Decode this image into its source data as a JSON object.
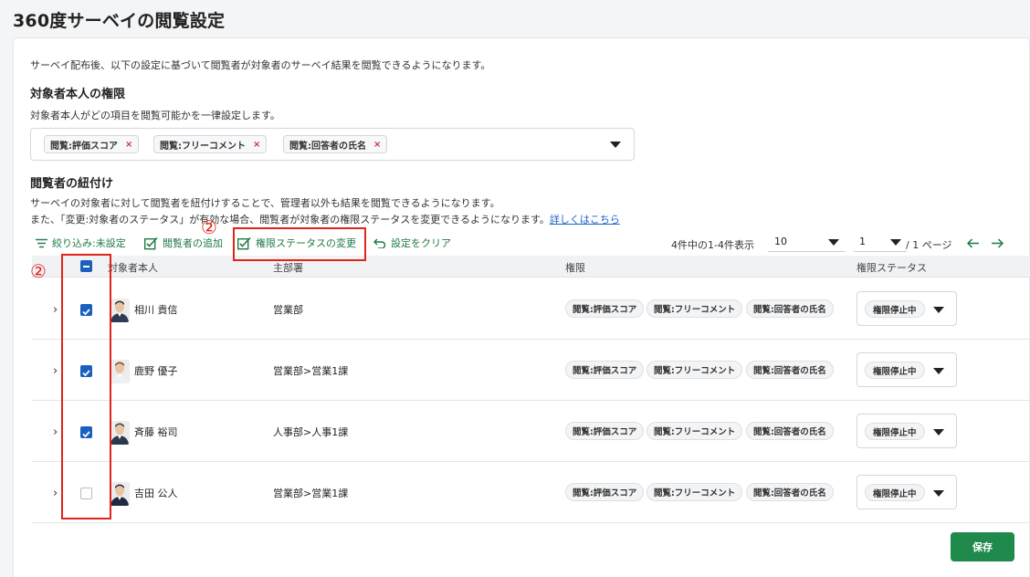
{
  "page": {
    "title": "360度サーベイの閲覧設定"
  },
  "intro": "サーベイ配布後、以下の設定に基づいて閲覧者が対象者のサーベイ結果を閲覧できるようになります。",
  "self_permission": {
    "title": "対象者本人の権限",
    "description": "対象者本人がどの項目を閲覧可能かを一律設定します。",
    "chips": [
      "閲覧:評価スコア",
      "閲覧:フリーコメント",
      "閲覧:回答者の氏名"
    ],
    "chip_remove": "×"
  },
  "linking": {
    "title": "閲覧者の紐付け",
    "description1": "サーベイの対象者に対して閲覧者を紐付けすることで、管理者以外も結果を閲覧できるようになります。",
    "description2": "また、「変更:対象者のステータス」が有効な場合、閲覧者が対象者の権限ステータスを変更できるようになります。",
    "link": "詳しくはこちら"
  },
  "toolbar": {
    "filter": "絞り込み:未設定",
    "add_viewer": "閲覧者の追加",
    "change_status": "権限ステータスの変更",
    "clear": "設定をクリア"
  },
  "pagination": {
    "summary": "4件中の1-4件表示",
    "per_page": "10",
    "page": "1",
    "total": "/ 1 ページ"
  },
  "annotations": {
    "marker": "②"
  },
  "table": {
    "headers": {
      "subject": "対象者本人",
      "dept": "主部署",
      "permission": "権限",
      "status": "権限ステータス"
    },
    "permission_labels": [
      "閲覧:評価スコア",
      "閲覧:フリーコメント",
      "閲覧:回答者の氏名"
    ],
    "rows": [
      {
        "name": "相川 貴信",
        "dept": "営業部",
        "status": "権限停止中",
        "checked": true
      },
      {
        "name": "鹿野 優子",
        "dept": "営業部>営業1課",
        "status": "権限停止中",
        "checked": true
      },
      {
        "name": "斉藤 裕司",
        "dept": "人事部>人事1課",
        "status": "権限停止中",
        "checked": true
      },
      {
        "name": "吉田 公人",
        "dept": "営業部>営業1課",
        "status": "権限停止中",
        "checked": false
      }
    ]
  },
  "actions": {
    "save": "保存"
  },
  "colors": {
    "primary": "#1f8a4c",
    "checkbox": "#1b5fbf",
    "annotation": "#e2231a",
    "link": "#1b66c9"
  }
}
